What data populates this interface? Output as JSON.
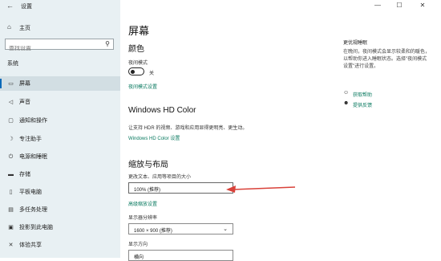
{
  "window": {
    "title": "设置",
    "minimize": "—",
    "maximize": "☐",
    "close": "✕"
  },
  "sidebar": {
    "home_label": "主页",
    "search_placeholder": "查找设置",
    "section_label": "系统",
    "items": [
      {
        "label": "屏幕",
        "icon": "monitor-icon",
        "glyph": "▭",
        "selected": true
      },
      {
        "label": "声音",
        "icon": "speaker-icon",
        "glyph": "◁"
      },
      {
        "label": "通知和操作",
        "icon": "notification-icon",
        "glyph": "▢"
      },
      {
        "label": "专注助手",
        "icon": "moon-icon",
        "glyph": "☽"
      },
      {
        "label": "电源和睡眠",
        "icon": "power-icon",
        "glyph": "⏻"
      },
      {
        "label": "存储",
        "icon": "storage-icon",
        "glyph": "▬"
      },
      {
        "label": "平板电脑",
        "icon": "tablet-icon",
        "glyph": "▯"
      },
      {
        "label": "多任务处理",
        "icon": "multitask-icon",
        "glyph": "▤"
      },
      {
        "label": "投影到此电脑",
        "icon": "project-icon",
        "glyph": "▣"
      },
      {
        "label": "体验共享",
        "icon": "share-icon",
        "glyph": "✕"
      }
    ]
  },
  "main": {
    "page_title": "屏幕",
    "color_heading": "颜色",
    "night_light_label": "夜间模式",
    "night_light_state": "关",
    "night_light_settings_link": "夜间模式设置",
    "hd_color_heading": "Windows HD Color",
    "hd_color_desc": "让支持 HDR 的视频、游戏和应用显得更明亮、更生动。",
    "hd_color_link": "Windows HD Color 设置",
    "scale_heading": "缩放与布局",
    "scale_label": "更改文本、应用等项目的大小",
    "scale_value": "100% (推荐)",
    "advanced_scaling_link": "高级缩放设置",
    "resolution_label": "显示器分辨率",
    "resolution_value": "1600 × 900 (推荐)",
    "orientation_label": "显示方向",
    "orientation_value": "横向"
  },
  "right_panel": {
    "title": "更优规睡眠",
    "desc": "在晚间，夜间模式会显示较柔和的暖色，以帮助你进入睡眠状态。选择\"夜间模式设置\"进行设置。",
    "help_link": "获取帮助",
    "feedback_link": "提供反馈"
  },
  "colors": {
    "accent": "#0a69b8",
    "link": "#0a7a60",
    "annotation_arrow": "#d9423a"
  }
}
